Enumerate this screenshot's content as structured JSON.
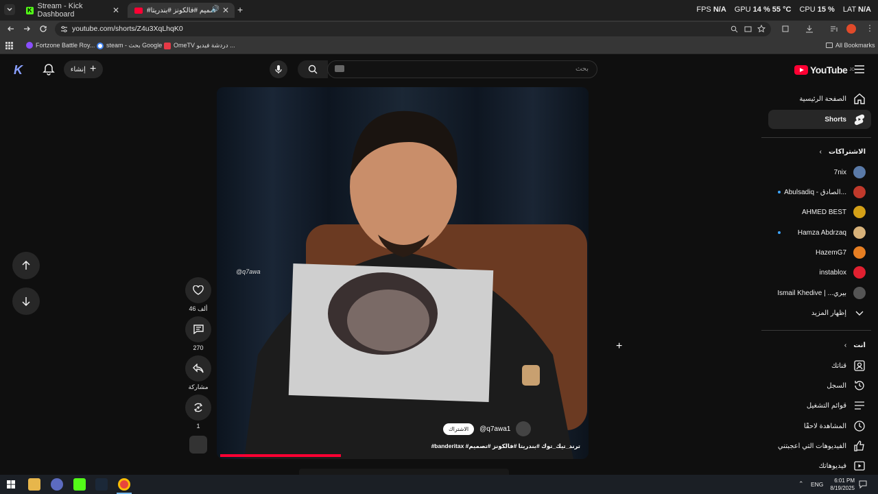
{
  "browser": {
    "tabs": [
      {
        "title": "Stream - Kick Dashboard"
      },
      {
        "title": "#تصميم #فالكونز #بندريتا"
      }
    ],
    "url": "youtube.com/shorts/Z4u3XqLhqK0",
    "bookmarks": [
      {
        "label": "Fortzone Battle Roy..."
      },
      {
        "label": "steam - بحث Google"
      },
      {
        "label": "OmeTV دردشة فيديو ..."
      }
    ],
    "all_bookmarks": "All Bookmarks"
  },
  "overlay": {
    "fps_label": "FPS",
    "fps_value": "N/A",
    "gpu_label": "GPU",
    "gpu_value": "14 % 55 °C",
    "cpu_label": "CPU",
    "cpu_value": "15 %",
    "lat_label": "LAT",
    "lat_value": "N/A"
  },
  "header": {
    "create_label": "إنشاء",
    "search_placeholder": "بحث",
    "logo_text": "YouTube",
    "logo_superscript": "JO"
  },
  "sidebar": {
    "main": [
      {
        "label": "الصفحة الرئيسية",
        "icon": "home-icon"
      },
      {
        "label": "Shorts",
        "icon": "shorts-icon"
      }
    ],
    "subscriptions_title": "الاشتراكات",
    "subscriptions": [
      {
        "label": "7nix",
        "color": "#5a7aa8"
      },
      {
        "label": "Abulsadiq - الصادق...",
        "color": "#c0392b"
      },
      {
        "label": "AHMED BEST",
        "color": "#d4a017"
      },
      {
        "label": "Hamza Abdrzaq",
        "color": "#d8b27a"
      },
      {
        "label": "HazemG7",
        "color": "#e67e22"
      },
      {
        "label": "instablox",
        "color": "#e02030"
      },
      {
        "label": "Ismail Khedive | ...بيري",
        "color": "#555555"
      }
    ],
    "show_more": "إظهار المزيد",
    "you_title": "أنت",
    "you_items": [
      {
        "label": "قناتك",
        "icon": "person-icon"
      },
      {
        "label": "السجل",
        "icon": "history-icon"
      },
      {
        "label": "قوائم التشغيل",
        "icon": "playlist-icon"
      },
      {
        "label": "المشاهدة لاحقًا",
        "icon": "clock-icon"
      },
      {
        "label": "الفيديوهات التي أعجبتني",
        "icon": "thumb-up-icon"
      },
      {
        "label": "فيديوهاتك",
        "icon": "video-icon"
      }
    ]
  },
  "short": {
    "likes": "46 ألف",
    "comments": "270",
    "share": "مشاركة",
    "remix": "1",
    "channel": "@q7awa1",
    "subscribe": "الاشتراك",
    "caption": "#banderitax #ترند_تيك_توك #بندريتا #فالكونز #تصميم",
    "watermark": "@q7awa",
    "progress": 0.33
  },
  "taskbar": {
    "lang": "ENG",
    "time": "6:01 PM",
    "date": "8/19/2025"
  }
}
